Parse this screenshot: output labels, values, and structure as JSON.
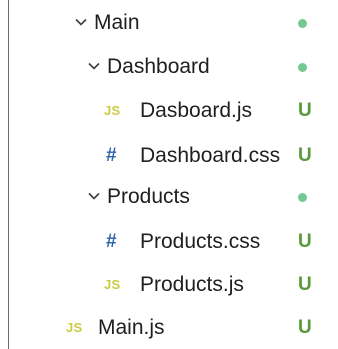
{
  "colors": {
    "added": "#5a9a3d",
    "dot": "#73c991",
    "js_icon": "#cbcb41",
    "css_icon": "#2e63a8",
    "guide": "#6b6b6b",
    "chevron": "#3c3c3c"
  },
  "tree": {
    "main_folder": {
      "label": "Main",
      "icon": "chevron-down-icon"
    },
    "dashboard_folder": {
      "label": "Dashboard",
      "icon": "chevron-down-icon"
    },
    "dasboard_js": {
      "label": "Dasboard.js",
      "icon_text": "JS",
      "badge": "U"
    },
    "dashboard_css": {
      "label": "Dashboard.css",
      "icon_text": "#",
      "badge": "U"
    },
    "products_folder": {
      "label": "Products",
      "icon": "chevron-down-icon"
    },
    "products_css": {
      "label": "Products.css",
      "icon_text": "#",
      "badge": "U"
    },
    "products_js": {
      "label": "Products.js",
      "icon_text": "JS",
      "badge": "U"
    },
    "main_js": {
      "label": "Main.js",
      "icon_text": "JS",
      "badge": "U"
    }
  }
}
